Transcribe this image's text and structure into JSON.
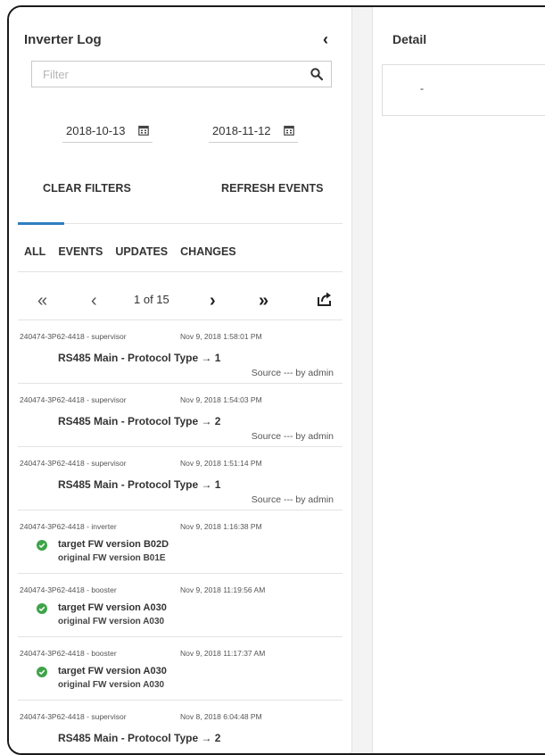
{
  "inverter_log": {
    "title": "Inverter Log",
    "filter_placeholder": "Filter",
    "date_from": "2018-10-13",
    "date_to": "2018-11-12",
    "clear_filters": "CLEAR FILTERS",
    "refresh_events": "REFRESH EVENTS",
    "tabs": [
      "ALL",
      "EVENTS",
      "UPDATES",
      "CHANGES"
    ],
    "pager": {
      "page_text": "1 of 15"
    },
    "entries": [
      {
        "meta": "240474-3P62-4418 - supervisor",
        "time": "Nov 9, 2018 1:58:01 PM",
        "change": "RS485 Main - Protocol Type → 1",
        "source": "Source --- by admin"
      },
      {
        "meta": "240474-3P62-4418 - supervisor",
        "time": "Nov 9, 2018 1:54:03 PM",
        "change": "RS485 Main - Protocol Type → 2",
        "source": "Source --- by admin"
      },
      {
        "meta": "240474-3P62-4418 - supervisor",
        "time": "Nov 9, 2018 1:51:14 PM",
        "change": "RS485 Main - Protocol Type → 1",
        "source": "Source --- by admin"
      },
      {
        "meta": "240474-3P62-4418 - inverter",
        "time": "Nov 9, 2018 1:16:38 PM",
        "target": "target FW version B02D",
        "original": "original FW version B01E"
      },
      {
        "meta": "240474-3P62-4418 - booster",
        "time": "Nov 9, 2018 11:19:56 AM",
        "target": "target FW version A030",
        "original": "original FW version A030"
      },
      {
        "meta": "240474-3P62-4418 - booster",
        "time": "Nov 9, 2018 11:17:37 AM",
        "target": "target FW version A030",
        "original": "original FW version A030"
      },
      {
        "meta": "240474-3P62-4418 - supervisor",
        "time": "Nov 8, 2018 6:04:48 PM",
        "change": "RS485 Main - Protocol Type → 2"
      }
    ]
  },
  "detail": {
    "title": "Detail",
    "value": "-"
  },
  "colors": {
    "accent": "#2f7fc1",
    "success": "#3ea34a"
  },
  "icons": {
    "collapse": "chevron-left-icon",
    "search": "search-icon",
    "calendar": "calendar-icon",
    "first": "double-chevron-left-icon",
    "prev": "chevron-left-icon",
    "next": "chevron-right-icon",
    "last": "double-chevron-right-icon",
    "export": "export-icon",
    "status": "check-circle-icon"
  }
}
